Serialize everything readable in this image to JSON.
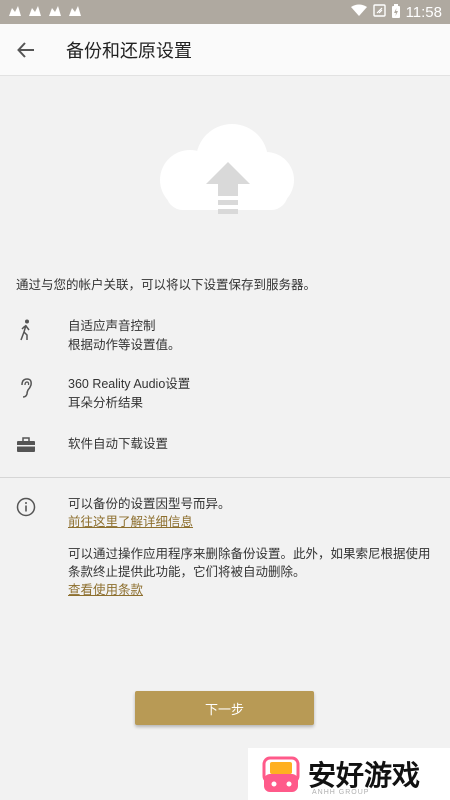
{
  "status_bar": {
    "time": "11:58",
    "battery_icon": "battery-charging-icon",
    "wifi_icon": "wifi-icon"
  },
  "app_bar": {
    "title": "备份和还原设置",
    "back_icon": "arrow-back-icon"
  },
  "hero_icon": "cloud-upload-icon",
  "intro_text": "通过与您的帐户关联，可以将以下设置保存到服务器。",
  "features": [
    {
      "icon": "walking-person-icon",
      "line1": "自适应声音控制",
      "line2": "根据动作等设置值。"
    },
    {
      "icon": "ear-icon",
      "line1": "360 Reality Audio设置",
      "line2": "耳朵分析结果"
    },
    {
      "icon": "toolbox-icon",
      "line1": "软件自动下载设置",
      "line2": ""
    }
  ],
  "notes": {
    "info_icon": "info-icon",
    "note1": "可以备份的设置因型号而异。",
    "learn_more_link": "前往这里了解详细信息",
    "note2": "可以通过操作应用程序来删除备份设置。此外，如果索尼根据使用条款终止提供此功能，它们将被自动删除。",
    "terms_link": "查看使用条款"
  },
  "next_button": "下一步",
  "watermark": {
    "text": "安好游戏",
    "sub": "ANHH GROUP"
  },
  "colors": {
    "accent": "#b89a55",
    "link": "#8d6f2e",
    "status_bar": "#afa9a0"
  }
}
